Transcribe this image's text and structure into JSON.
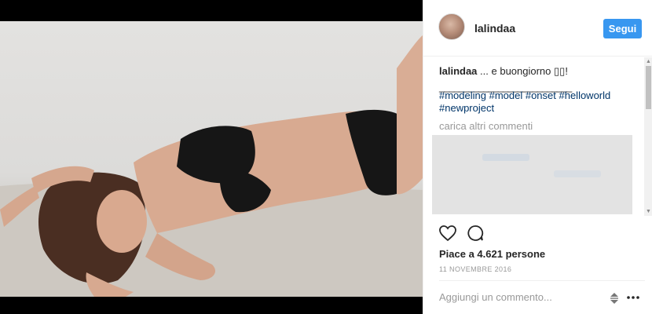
{
  "post": {
    "username": "lalindaa",
    "follow_label": "Segui",
    "caption_user": "lalindaa",
    "caption_text": "... e buongiorno ▯▯!",
    "caption_underline": "___________________________",
    "hashtags": "#modeling #model #onset #helloworld #newproject",
    "load_more": "carica altri commenti",
    "likes_text": "Piace a 4.621 persone",
    "date": "11 NOVEMBRE 2016",
    "comment_placeholder": "Aggiungi un commento..."
  },
  "icons": {
    "like": "heart-icon",
    "comment": "comment-icon",
    "sort": "sort-icon",
    "options": "more-options-icon"
  },
  "colors": {
    "accent": "#3897f0",
    "hashtag": "#003569",
    "muted": "#999999",
    "text": "#262626"
  }
}
